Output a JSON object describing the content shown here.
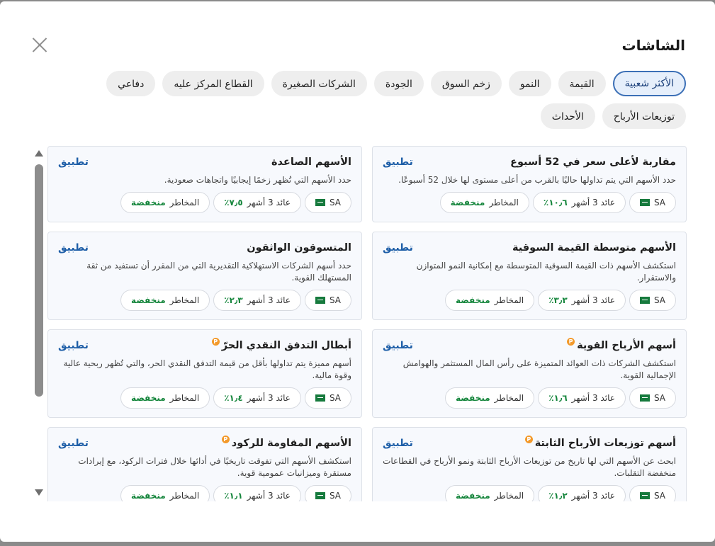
{
  "dialog": {
    "title": "الشاشات"
  },
  "tabs": [
    {
      "label": "الأكثر شعبية",
      "active": true
    },
    {
      "label": "القيمة"
    },
    {
      "label": "النمو"
    },
    {
      "label": "زخم السوق"
    },
    {
      "label": "الجودة"
    },
    {
      "label": "الشركات الصغيرة"
    },
    {
      "label": "القطاع المركز عليه"
    },
    {
      "label": "دفاعي"
    },
    {
      "label": "توزيعات الأرباح"
    },
    {
      "label": "الأحداث"
    }
  ],
  "labels": {
    "apply": "تطبيق",
    "market": "SA",
    "return_3m": "عائد 3 أشهر",
    "risk": "المخاطر",
    "risk_low": "منخفضة",
    "premium": "P"
  },
  "cards": [
    {
      "title": "مقاربة لأعلى سعر في 52 أسبوع",
      "premium": false,
      "desc": "حدد الأسهم التي يتم تداولها حاليًا بالقرب من أعلى مستوى لها خلال 52 أسبوعًا.",
      "return": "١٠٫٦٪"
    },
    {
      "title": "الأسهم الصاعدة",
      "premium": false,
      "desc": "حدد الأسهم التي تُظهر زخمًا إيجابيًا واتجاهات صعودية.",
      "return": "٧٫٥٪"
    },
    {
      "title": "الأسهم متوسطة القيمة السوقية",
      "premium": false,
      "desc": "استكشف الأسهم ذات القيمة السوقية المتوسطة مع إمكانية النمو المتوازن والاستقرار.",
      "return": "٣٫٣٪"
    },
    {
      "title": "المتسوقون الواثقون",
      "premium": false,
      "desc": "حدد أسهم الشركات الاستهلاكية التقديرية التي من المقرر أن تستفيد من ثقة المستهلك القوية.",
      "return": "٢٫٣٪"
    },
    {
      "title": "أسهم الأرباح القوية",
      "premium": true,
      "desc": "استكشف الشركات ذات العوائد المتميزة على رأس المال المستثمر والهوامش الإجمالية القوية.",
      "return": "١٫٦٪"
    },
    {
      "title": "أبطال التدفق النقدي الحرّ",
      "premium": true,
      "desc": "أسهم مميزة يتم تداولها بأقل من قيمة التدفق النقدي الحر، والتي تُظهر ربحية عالية وقوة مالية.",
      "return": "١٫٤٪"
    },
    {
      "title": "أسهم توزيعات الأرباح الثابتة",
      "premium": true,
      "desc": "ابحث عن الأسهم التي لها تاريخ من توزيعات الأرباح الثابتة ونمو الأرباح في القطاعات منخفضة التقلبات.",
      "return": "١٫٢٪"
    },
    {
      "title": "الأسهم المقاومة للركود",
      "premium": true,
      "desc": "استكشف الأسهم التي تفوقت تاريخيًا في أدائها خلال فترات الركود، مع إيرادات مستقرة وميزانيات عمومية قوية.",
      "return": "١٫١٪"
    }
  ]
}
